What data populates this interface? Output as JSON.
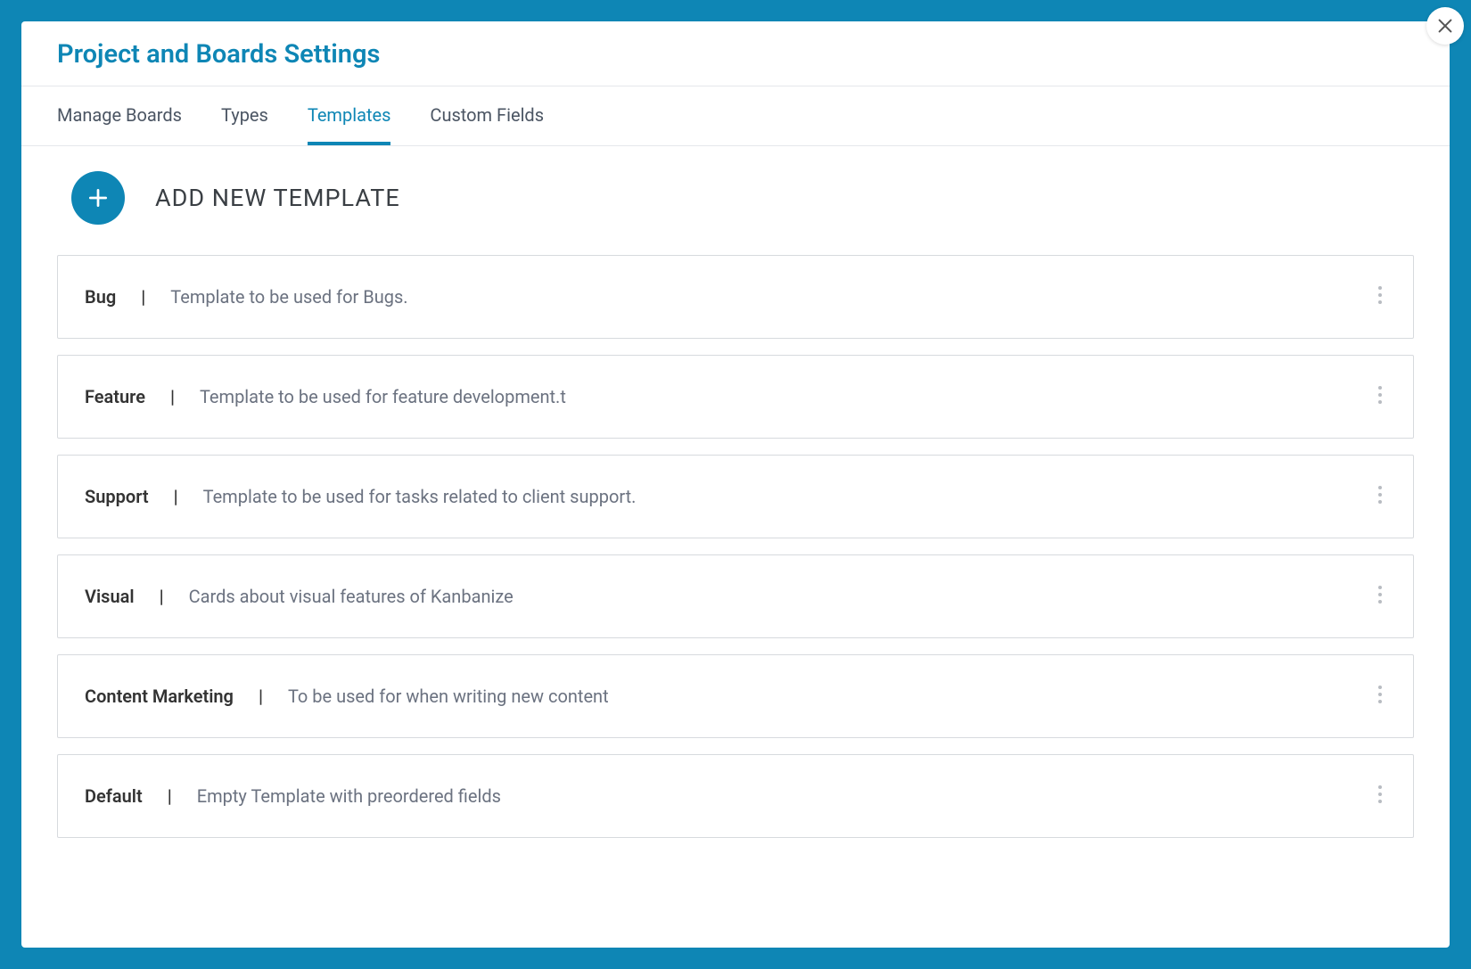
{
  "header": {
    "title": "Project and Boards Settings"
  },
  "tabs": [
    {
      "label": "Manage Boards",
      "active": false
    },
    {
      "label": "Types",
      "active": false
    },
    {
      "label": "Templates",
      "active": true
    },
    {
      "label": "Custom Fields",
      "active": false
    }
  ],
  "addNew": {
    "label": "ADD NEW TEMPLATE"
  },
  "templates": [
    {
      "name": "Bug",
      "desc": "Template to be used for Bugs."
    },
    {
      "name": "Feature",
      "desc": "Template to be used for feature development.t"
    },
    {
      "name": "Support",
      "desc": "Template to be used for tasks related to client support."
    },
    {
      "name": "Visual",
      "desc": "Cards about visual features of Kanbanize"
    },
    {
      "name": "Content Marketing",
      "desc": "To be used for when writing new content"
    },
    {
      "name": "Default",
      "desc": "Empty Template with preordered fields"
    }
  ],
  "separator": "|"
}
